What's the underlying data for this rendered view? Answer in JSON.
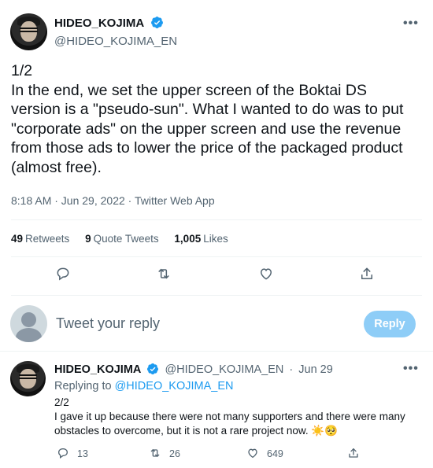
{
  "main_tweet": {
    "display_name": "HIDEO_KOJIMA",
    "handle": "@HIDEO_KOJIMA_EN",
    "more": "•••",
    "text": "1/2\nIn the end, we set the upper screen of the Boktai DS version is a \"pseudo-sun\". What I wanted to do was to put \"corporate ads\" on the upper screen and use the revenue from those ads to lower the price of the packaged product (almost free).",
    "meta": "8:18 AM · Jun 29, 2022 · Twitter Web App",
    "stats": {
      "retweets_count": "49",
      "retweets_label": "Retweets",
      "quotes_count": "9",
      "quotes_label": "Quote Tweets",
      "likes_count": "1,005",
      "likes_label": "Likes"
    },
    "icons": [
      "reply-icon",
      "retweet-icon",
      "like-icon",
      "share-icon"
    ]
  },
  "composer": {
    "placeholder": "Tweet your reply",
    "button": "Reply",
    "button_color": "#8ecdf7"
  },
  "reply_tweet": {
    "display_name": "HIDEO_KOJIMA",
    "handle": "@HIDEO_KOJIMA_EN",
    "dot": "·",
    "date": "Jun 29",
    "more": "•••",
    "replying_prefix": "Replying to",
    "replying_to": "@HIDEO_KOJIMA_EN",
    "line1": "2/2",
    "text": "I gave it up because there were not many supporters and there were many obstacles to overcome, but it is not a rare project now. ☀️🥺",
    "replies": "13",
    "retweets": "26",
    "likes": "649"
  },
  "colors": {
    "verified": "#1d9bf0",
    "secondary_text": "#536471",
    "link": "#1d9bf0"
  }
}
